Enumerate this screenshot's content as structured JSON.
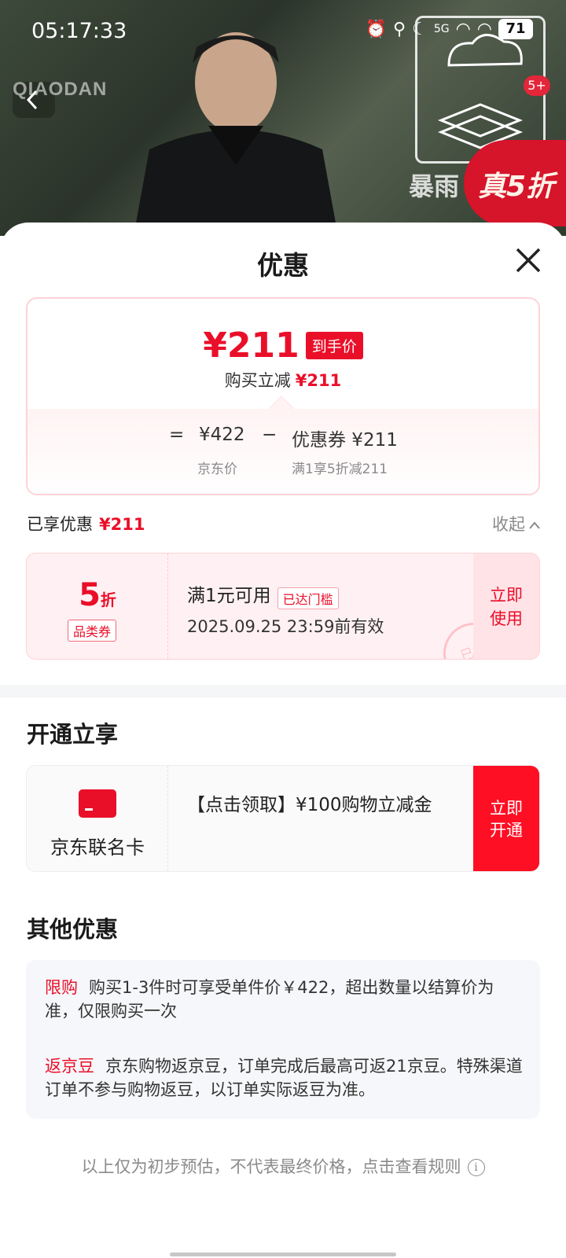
{
  "status_bar": {
    "time": "05:17:33",
    "battery": "71",
    "network": "5G"
  },
  "banner": {
    "brand": "QIAODAN",
    "storm_text": "暴雨",
    "deal_text": "真5折",
    "count_badge": "5+"
  },
  "sheet": {
    "title": "优惠"
  },
  "price_card": {
    "final_price": "¥211",
    "final_tag": "到手价",
    "saving_label": "购买立减",
    "saving_amount": "¥211",
    "equals": "=",
    "base_price": "¥422",
    "minus": "−",
    "coupon_text": "优惠券 ¥211",
    "base_label": "京东价",
    "coupon_label": "满1享5折减211"
  },
  "enjoyed": {
    "label": "已享优惠",
    "amount": "¥211",
    "collapse": "收起"
  },
  "coupon": {
    "discount_num": "5",
    "discount_unit": "折",
    "category": "品类券",
    "condition": "满1元可用",
    "reached": "已达门槛",
    "validity": "2025.09.25 23:59前有效",
    "use_line1": "立即",
    "use_line2": "使用",
    "stamp": "已领"
  },
  "open_section": {
    "title": "开通立享",
    "card_name": "京东联名卡",
    "description": "【点击领取】¥100购物立减金",
    "open_line1": "立即",
    "open_line2": "开通"
  },
  "other_section": {
    "title": "其他优惠",
    "items": [
      {
        "label": "限购",
        "text": "购买1-3件时可享受单件价￥422，超出数量以结算价为准，仅限购买一次"
      },
      {
        "label": "返京豆",
        "text": "京东购物返京豆，订单完成后最高可返21京豆。特殊渠道订单不参与购物返豆，以订单实际返豆为准。"
      }
    ]
  },
  "footer": {
    "note": "以上仅为初步预估，不代表最终价格，点击查看规则",
    "info_icon": "i"
  },
  "colors": {
    "accent": "#ea0f29",
    "coupon_bg": "#fff1f3",
    "open_button": "#ff0f23"
  }
}
